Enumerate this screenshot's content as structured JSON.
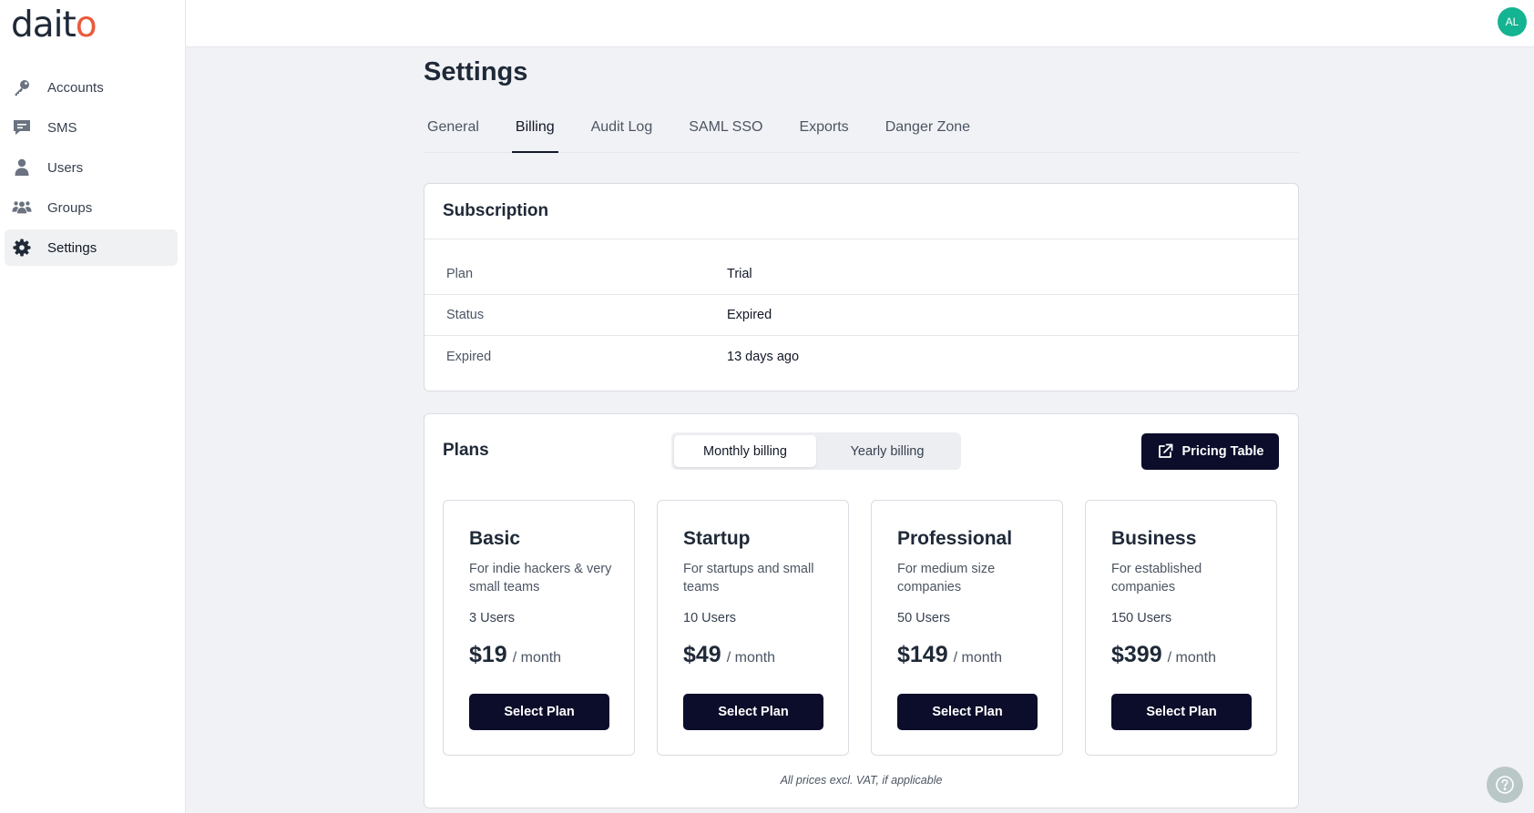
{
  "brand": {
    "logo_main": "dait",
    "logo_dot": "o"
  },
  "sidebar": {
    "items": [
      {
        "label": "Accounts",
        "icon": "key-icon"
      },
      {
        "label": "SMS",
        "icon": "message-icon"
      },
      {
        "label": "Users",
        "icon": "user-icon"
      },
      {
        "label": "Groups",
        "icon": "users-group-icon"
      },
      {
        "label": "Settings",
        "icon": "gear-icon",
        "active": true
      }
    ]
  },
  "header": {
    "avatar_initials": "AL"
  },
  "page": {
    "title": "Settings"
  },
  "tabs": [
    {
      "label": "General"
    },
    {
      "label": "Billing",
      "active": true
    },
    {
      "label": "Audit Log"
    },
    {
      "label": "SAML SSO"
    },
    {
      "label": "Exports"
    },
    {
      "label": "Danger Zone"
    }
  ],
  "subscription": {
    "title": "Subscription",
    "rows": [
      {
        "label": "Plan",
        "value": "Trial"
      },
      {
        "label": "Status",
        "value": "Expired"
      },
      {
        "label": "Expired",
        "value": "13 days ago"
      }
    ]
  },
  "plans": {
    "title": "Plans",
    "billing_options": [
      {
        "label": "Monthly billing",
        "active": true
      },
      {
        "label": "Yearly billing"
      }
    ],
    "pricing_table_label": "Pricing Table",
    "items": [
      {
        "name": "Basic",
        "description": "For indie hackers & very small teams",
        "users": "3 Users",
        "price": "$19",
        "period": "/ month",
        "button": "Select Plan"
      },
      {
        "name": "Startup",
        "description": "For startups and small teams",
        "users": "10 Users",
        "price": "$49",
        "period": "/ month",
        "button": "Select Plan"
      },
      {
        "name": "Professional",
        "description": "For medium size companies",
        "users": "50 Users",
        "price": "$149",
        "period": "/ month",
        "button": "Select Plan"
      },
      {
        "name": "Business",
        "description": "For established companies",
        "users": "150 Users",
        "price": "$399",
        "period": "/ month",
        "button": "Select Plan"
      }
    ],
    "footnote": "All prices excl. VAT, if applicable"
  },
  "colors": {
    "accent_dark": "#0b0d2a",
    "avatar": "#14b391",
    "logo_dot": "#ea5a3c"
  }
}
